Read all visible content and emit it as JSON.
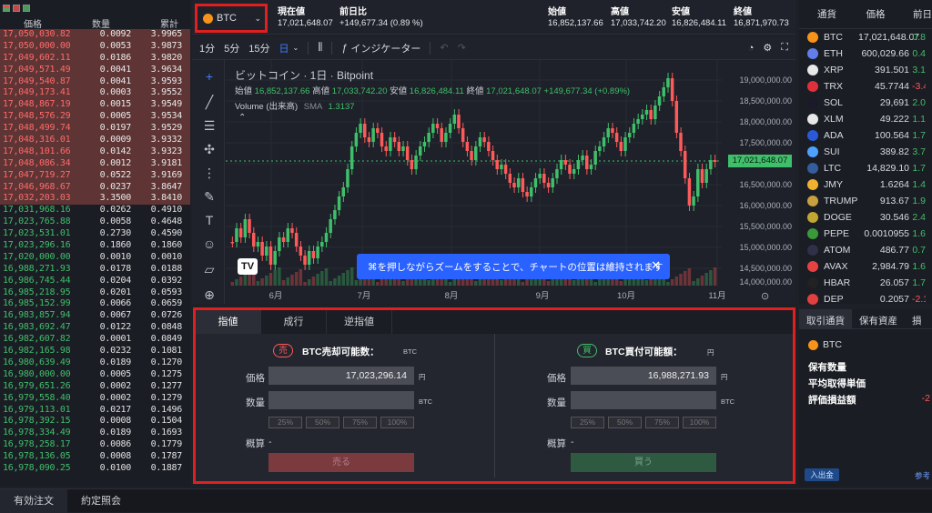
{
  "orderbook": {
    "headers": {
      "price": "価格",
      "qty": "数量",
      "total": "累計"
    },
    "asks": [
      [
        "17,050,030.82",
        "0.0092",
        "3.9965"
      ],
      [
        "17,050,000.00",
        "0.0053",
        "3.9873"
      ],
      [
        "17,049,602.11",
        "0.0186",
        "3.9820"
      ],
      [
        "17,049,571.49",
        "0.0041",
        "3.9634"
      ],
      [
        "17,049,540.87",
        "0.0041",
        "3.9593"
      ],
      [
        "17,049,173.41",
        "0.0003",
        "3.9552"
      ],
      [
        "17,048,867.19",
        "0.0015",
        "3.9549"
      ],
      [
        "17,048,576.29",
        "0.0005",
        "3.9534"
      ],
      [
        "17,048,499.74",
        "0.0197",
        "3.9529"
      ],
      [
        "17,048,316.01",
        "0.0009",
        "3.9332"
      ],
      [
        "17,048,101.66",
        "0.0142",
        "3.9323"
      ],
      [
        "17,048,086.34",
        "0.0012",
        "3.9181"
      ],
      [
        "17,047,719.27",
        "0.0522",
        "3.9169"
      ],
      [
        "17,046,968.67",
        "0.0237",
        "3.8647"
      ],
      [
        "17,032,203.03",
        "3.3500",
        "3.8410"
      ]
    ],
    "bids": [
      [
        "17,031,968.16",
        "0.0262",
        "0.4910"
      ],
      [
        "17,023,765.88",
        "0.0058",
        "0.4648"
      ],
      [
        "17,023,531.01",
        "0.2730",
        "0.4590"
      ],
      [
        "17,023,296.16",
        "0.1860",
        "0.1860"
      ],
      [
        "17,020,000.00",
        "0.0010",
        "0.0010"
      ],
      [
        "16,988,271.93",
        "0.0178",
        "0.0188"
      ],
      [
        "16,986,745.44",
        "0.0204",
        "0.0392"
      ],
      [
        "16,985,218.95",
        "0.0201",
        "0.0593"
      ],
      [
        "16,985,152.99",
        "0.0066",
        "0.0659"
      ],
      [
        "16,983,857.94",
        "0.0067",
        "0.0726"
      ],
      [
        "16,983,692.47",
        "0.0122",
        "0.0848"
      ],
      [
        "16,982,607.82",
        "0.0001",
        "0.0849"
      ],
      [
        "16,982,165.98",
        "0.0232",
        "0.1081"
      ],
      [
        "16,980,639.49",
        "0.0189",
        "0.1270"
      ],
      [
        "16,980,000.00",
        "0.0005",
        "0.1275"
      ],
      [
        "16,979,651.26",
        "0.0002",
        "0.1277"
      ],
      [
        "16,979,558.40",
        "0.0002",
        "0.1279"
      ],
      [
        "16,979,113.01",
        "0.0217",
        "0.1496"
      ],
      [
        "16,978,392.15",
        "0.0008",
        "0.1504"
      ],
      [
        "16,978,334.49",
        "0.0189",
        "0.1693"
      ],
      [
        "16,978,258.17",
        "0.0086",
        "0.1779"
      ],
      [
        "16,978,136.05",
        "0.0008",
        "0.1787"
      ],
      [
        "16,978,090.25",
        "0.0100",
        "0.1887"
      ]
    ]
  },
  "header": {
    "pair": "BTC",
    "stats": [
      {
        "label": "現在値",
        "value": "17,021,648.07"
      },
      {
        "label": "前日比",
        "value": "+149,677.34 (0.89 %)"
      },
      {
        "label": "始値",
        "value": "16,852,137.66"
      },
      {
        "label": "高値",
        "value": "17,033,742.20"
      },
      {
        "label": "安値",
        "value": "16,826,484.11"
      },
      {
        "label": "終値",
        "value": "16,871,970.73"
      }
    ]
  },
  "toolbar": {
    "intervals": [
      "1分",
      "5分",
      "15分",
      "日"
    ],
    "indicator_label": "インジケーター"
  },
  "chart": {
    "title": "ビットコイン · 1日 · Bitpoint",
    "ohlc": {
      "o_label": "始値",
      "o": "16,852,137.66",
      "h_label": "高値",
      "h": "17,033,742.20",
      "l_label": "安値",
      "l": "16,826,484.11",
      "c_label": "終値",
      "c": "17,021,648.07",
      "chg": "+149,677.34 (+0.89%)"
    },
    "volume_label": "Volume (出来高)",
    "sma_label": "SMA",
    "sma_value": "1.3137",
    "price_tag": "17,021,648.07",
    "toast": "⌘を押しながらズームをすることで、チャートの位置は維持されます",
    "y_ticks": [
      "19,000,000.00",
      "18,500,000.00",
      "18,000,000.00",
      "17,500,000.00",
      "16,500,000.00",
      "16,000,000.00",
      "15,500,000.00",
      "15,000,000.00",
      "14,500,000.00",
      "14,000,000.00"
    ],
    "x_ticks": [
      "6月",
      "7月",
      "8月",
      "9月",
      "10月",
      "11月"
    ],
    "colors": {
      "up": "#3fbf6a",
      "down": "#ff5a5a"
    }
  },
  "order": {
    "tabs": [
      "指値",
      "成行",
      "逆指値"
    ],
    "sell": {
      "badge": "売",
      "title": "BTC売却可能数：",
      "title_unit": "BTC",
      "price_label": "価格",
      "price": "17,023,296.14",
      "price_unit": "円",
      "qty_label": "数量",
      "qty_unit": "BTC",
      "est_label": "概算",
      "est": "-",
      "button": "売る"
    },
    "buy": {
      "badge": "買",
      "title": "BTC買付可能額：",
      "title_unit": "円",
      "price_label": "価格",
      "price": "16,988,271.93",
      "price_unit": "円",
      "qty_label": "数量",
      "qty_unit": "BTC",
      "est_label": "概算",
      "est": "-",
      "button": "買う"
    },
    "percents": [
      "25%",
      "50%",
      "75%",
      "100%"
    ]
  },
  "coinlist": {
    "headers": {
      "currency": "通貨",
      "price": "価格",
      "change": "前日"
    },
    "rows": [
      {
        "sym": "BTC",
        "price": "17,021,648.07",
        "chg": "0.8",
        "color": "#f7931a",
        "dir": "up"
      },
      {
        "sym": "ETH",
        "price": "600,029.66",
        "chg": "0.4",
        "color": "#627eea",
        "dir": "up"
      },
      {
        "sym": "XRP",
        "price": "391.501",
        "chg": "3.1",
        "color": "#e8e8e8",
        "dir": "up"
      },
      {
        "sym": "TRX",
        "price": "45.7744",
        "chg": "-3.4",
        "color": "#e0303a",
        "dir": "down"
      },
      {
        "sym": "SOL",
        "price": "29,691",
        "chg": "2.0",
        "color": "#1a1a2a",
        "dir": "up"
      },
      {
        "sym": "XLM",
        "price": "49.222",
        "chg": "1.1",
        "color": "#e8e8e8",
        "dir": "up"
      },
      {
        "sym": "ADA",
        "price": "100.564",
        "chg": "1.7",
        "color": "#2a5ada",
        "dir": "up"
      },
      {
        "sym": "SUI",
        "price": "389.82",
        "chg": "3.7",
        "color": "#4da2ff",
        "dir": "up"
      },
      {
        "sym": "LTC",
        "price": "14,829.10",
        "chg": "1.7",
        "color": "#345d9d",
        "dir": "up"
      },
      {
        "sym": "JMY",
        "price": "1.6264",
        "chg": "1.4",
        "color": "#f0b030",
        "dir": "up"
      },
      {
        "sym": "TRUMP",
        "price": "913.67",
        "chg": "1.9",
        "color": "#c8a040",
        "dir": "up"
      },
      {
        "sym": "DOGE",
        "price": "30.546",
        "chg": "2.4",
        "color": "#c2a633",
        "dir": "up"
      },
      {
        "sym": "PEPE",
        "price": "0.0010955",
        "chg": "1.6",
        "color": "#3a9a3a",
        "dir": "up"
      },
      {
        "sym": "ATOM",
        "price": "486.77",
        "chg": "0.7",
        "color": "#2e3148",
        "dir": "up"
      },
      {
        "sym": "AVAX",
        "price": "2,984.79",
        "chg": "1.6",
        "color": "#e84142",
        "dir": "up"
      },
      {
        "sym": "HBAR",
        "price": "26.057",
        "chg": "1.7",
        "color": "#222222",
        "dir": "up"
      },
      {
        "sym": "DEP",
        "price": "0.2057",
        "chg": "-2.1",
        "color": "#e04040",
        "dir": "down"
      }
    ]
  },
  "account": {
    "tabs": [
      "取引通貨",
      "保有資産",
      "損"
    ],
    "coin": "BTC",
    "items": [
      {
        "label": "保有数量",
        "value": ""
      },
      {
        "label": "平均取得単価",
        "value": ""
      },
      {
        "label": "評価損益額",
        "value": "-2"
      }
    ],
    "deposit_button": "入出金",
    "ref_label": "参考"
  },
  "bottom_tabs": [
    "有効注文",
    "約定照会"
  ]
}
